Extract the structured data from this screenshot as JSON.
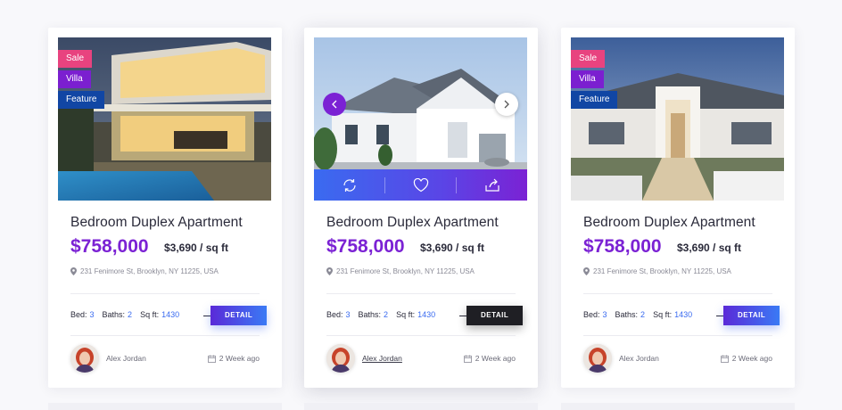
{
  "colors": {
    "accent": "#7b22d4",
    "blue": "#3a6bf0",
    "sale": "#e8437f",
    "villa": "#7b1fd0",
    "feature": "#1146a4"
  },
  "cards": [
    {
      "tags": [
        "Sale",
        "Villa",
        "Feature"
      ],
      "title": "Bedroom Duplex Apartment",
      "price": "$758,000",
      "price_per_sqft": "$3,690 / sq ft",
      "address": "231 Fenimore St, Brooklyn, NY 11225, USA",
      "bed_label": "Bed:",
      "bed": "3",
      "baths_label": "Baths:",
      "baths": "2",
      "sqft_label": "Sq ft:",
      "sqft": "1430",
      "detail_label": "DETAIL",
      "agent": "Alex Jordan",
      "posted": "2 Week ago"
    },
    {
      "title": "Bedroom Duplex Apartment",
      "price": "$758,000",
      "price_per_sqft": "$3,690 / sq ft",
      "address": "231 Fenimore St, Brooklyn, NY 11225, USA",
      "bed_label": "Bed:",
      "bed": "3",
      "baths_label": "Baths:",
      "baths": "2",
      "sqft_label": "Sq ft:",
      "sqft": "1430",
      "detail_label": "DETAIL",
      "agent": "Alex Jordan",
      "posted": "2 Week ago",
      "actions": [
        "refresh-icon",
        "heart-icon",
        "share-icon"
      ],
      "nav": [
        "chevron-left-icon",
        "chevron-right-icon"
      ]
    },
    {
      "tags": [
        "Sale",
        "Villa",
        "Feature"
      ],
      "title": "Bedroom Duplex Apartment",
      "price": "$758,000",
      "price_per_sqft": "$3,690 / sq ft",
      "address": "231 Fenimore St, Brooklyn, NY 11225, USA",
      "bed_label": "Bed:",
      "bed": "3",
      "baths_label": "Baths:",
      "baths": "2",
      "sqft_label": "Sq ft:",
      "sqft": "1430",
      "detail_label": "DETAIL",
      "agent": "Alex Jordan",
      "posted": "2 Week ago"
    }
  ]
}
